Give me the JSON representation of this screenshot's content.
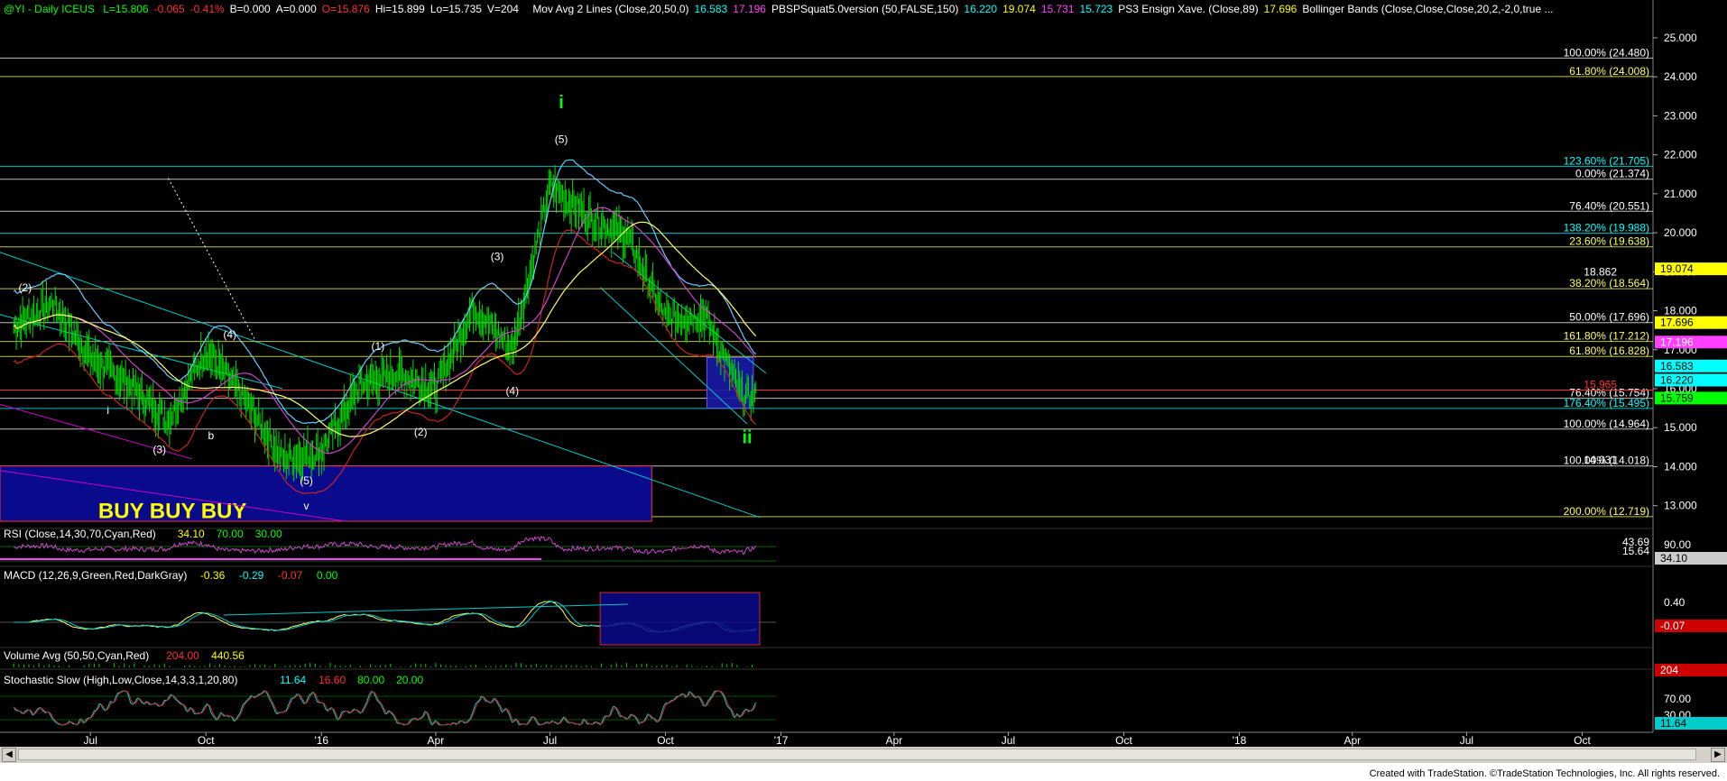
{
  "header": {
    "symbol": "@YI - Daily ICEUS",
    "quote": [
      {
        "label": "L=15.806",
        "color": "#00ff00"
      },
      {
        "label": "-0.065",
        "color": "#ff3030"
      },
      {
        "label": "-0.41%",
        "color": "#ff3030"
      },
      {
        "label": "B=0.000",
        "color": "#ffffff"
      },
      {
        "label": "A=0.000",
        "color": "#ffffff"
      },
      {
        "label": "O=15.876",
        "color": "#ff3030"
      },
      {
        "label": "Hi=15.899",
        "color": "#ffffff"
      },
      {
        "label": "Lo=15.735",
        "color": "#ffffff"
      },
      {
        "label": "V=204",
        "color": "#ffffff"
      }
    ],
    "studies": [
      {
        "label": "Mov Avg 2 Lines (Close,20,50,0)",
        "color": "#ffffff"
      },
      {
        "label": "16.583",
        "color": "#00ffff"
      },
      {
        "label": "17.196",
        "color": "#ff40ff"
      },
      {
        "label": "PBSPSquat5.0version (50,FALSE,150)",
        "color": "#ffffff"
      },
      {
        "label": "16.220",
        "color": "#00ffff"
      },
      {
        "label": "19.074",
        "color": "#ffff00"
      },
      {
        "label": "15.731",
        "color": "#ff40ff"
      },
      {
        "label": "15.723",
        "color": "#00ffff"
      },
      {
        "label": "PS3 Ensign Xave. (Close,89)",
        "color": "#ffffff"
      },
      {
        "label": "17.696",
        "color": "#ffff00"
      },
      {
        "label": "Bollinger Bands (Close,Close,Close,20,2,-2,0,true ...",
        "color": "#ffffff"
      }
    ]
  },
  "chart_data": {
    "type": "line",
    "x": [
      "2015-05-01",
      "2015-06-01",
      "2015-07-01",
      "2015-08-01",
      "2015-09-01",
      "2015-10-01",
      "2015-11-01",
      "2015-12-01",
      "2016-01-01",
      "2016-02-01",
      "2016-03-01",
      "2016-04-01",
      "2016-05-01",
      "2016-06-01",
      "2016-07-01",
      "2016-08-01",
      "2016-09-01",
      "2016-10-01",
      "2016-11-01",
      "2016-12-01"
    ],
    "series": [
      {
        "values": [
          17.6,
          18.2,
          16.8,
          16.1,
          15.2,
          17.0,
          15.7,
          14.2,
          14.4,
          16.1,
          16.4,
          16.0,
          18.1,
          17.0,
          21.2,
          20.4,
          19.9,
          17.8,
          17.9,
          15.8
        ]
      }
    ],
    "xticks": [
      "Jul",
      "Oct",
      "'16",
      "Apr",
      "Jul",
      "Oct",
      "'17",
      "Apr",
      "Jul",
      "Oct",
      "'18",
      "Apr",
      "Jul",
      "Oct"
    ],
    "yticks": [
      "25.000",
      "24.000",
      "23.000",
      "22.000",
      "21.000",
      "20.000",
      "19.000",
      "18.000",
      "17.000",
      "16.000",
      "15.000",
      "14.000",
      "13.000"
    ],
    "ylim": [
      12.6,
      25.6
    ],
    "last_price": "15.759",
    "price_markers": [
      {
        "value": 19.074,
        "label": "19.074",
        "bg": "#ffff00",
        "fg": "#000000"
      },
      {
        "value": 17.696,
        "label": "17.696",
        "bg": "#ffff00",
        "fg": "#000000"
      },
      {
        "value": 17.196,
        "label": "17.196",
        "bg": "#ff40ff",
        "fg": "#ffffff"
      },
      {
        "value": 16.583,
        "label": "16.583",
        "bg": "#00ffff",
        "fg": "#000000"
      },
      {
        "value": 16.22,
        "label": "16.220",
        "bg": "#00ffff",
        "fg": "#000000"
      },
      {
        "value": 15.759,
        "label": "15.759",
        "bg": "#00ff00",
        "fg": "#000000"
      }
    ],
    "fib_levels": [
      {
        "value": 24.48,
        "label": "100.00% (24.480)",
        "color": "#ffffff"
      },
      {
        "value": 24.008,
        "label": "61.80% (24.008)",
        "color": "#ffff66"
      },
      {
        "value": 21.705,
        "label": "123.60% (21.705)",
        "color": "#00ffff"
      },
      {
        "value": 21.374,
        "label": "0.00% (21.374)",
        "color": "#ffffff"
      },
      {
        "value": 20.551,
        "label": "76.40% (20.551)",
        "color": "#ffffff"
      },
      {
        "value": 19.988,
        "label": "138.20% (19.988)",
        "color": "#00ffff"
      },
      {
        "value": 19.638,
        "label": "23.60% (19.638)",
        "color": "#ffff66"
      },
      {
        "value": 18.564,
        "label": "38.20% (18.564)",
        "color": "#ffff66"
      },
      {
        "value": 17.696,
        "label": "50.00% (17.696)",
        "color": "#ffffff"
      },
      {
        "value": 17.212,
        "label": "161.80% (17.212)",
        "color": "#ffff66"
      },
      {
        "value": 16.828,
        "label": "61.80% (16.828)",
        "color": "#ffff66"
      },
      {
        "value": 15.754,
        "label": "76.40% (15.754)",
        "color": "#ffffff"
      },
      {
        "value": 15.495,
        "label": "176.40% (15.495)",
        "color": "#00ffff"
      },
      {
        "value": 14.964,
        "label": "100.00% (14.964)",
        "color": "#ffffff"
      },
      {
        "value": 14.018,
        "label": "100.00% (14.018)",
        "color": "#ffffff"
      },
      {
        "value": 12.719,
        "label": "200.00% (12.719)",
        "color": "#ffff66"
      }
    ],
    "annotations": [
      {
        "text": "18.862",
        "value": 18.862,
        "color": "#ffffff"
      },
      {
        "text": "15.965",
        "value": 15.965,
        "color": "#ff3030"
      },
      {
        "text": "14.031",
        "value": 14.031,
        "color": "#ffffff"
      }
    ],
    "wave_labels": [
      {
        "text": "i",
        "date": "2016-07-10",
        "value": 23.2,
        "color": "#00ff00",
        "size": "big"
      },
      {
        "text": "(5)",
        "date": "2016-07-10",
        "value": 22.3,
        "color": "#ffffff"
      },
      {
        "text": "(3)",
        "date": "2016-05-20",
        "value": 19.3,
        "color": "#ffffff"
      },
      {
        "text": "(4)",
        "date": "2016-06-01",
        "value": 15.85,
        "color": "#ffffff"
      },
      {
        "text": "(1)",
        "date": "2016-02-15",
        "value": 17.0,
        "color": "#ffffff"
      },
      {
        "text": "(2)",
        "date": "2016-03-20",
        "value": 14.8,
        "color": "#ffffff"
      },
      {
        "text": "(4)",
        "date": "2015-10-20",
        "value": 17.3,
        "color": "#ffffff"
      },
      {
        "text": "(2)",
        "date": "2015-05-10",
        "value": 18.5,
        "color": "#ffffff"
      },
      {
        "text": "(3)",
        "date": "2015-08-25",
        "value": 14.35,
        "color": "#ffffff"
      },
      {
        "text": "b",
        "date": "2015-10-05",
        "value": 14.7,
        "color": "#ffffff"
      },
      {
        "text": "i",
        "date": "2015-07-15",
        "value": 15.35,
        "color": "#ffffff"
      },
      {
        "text": "(5)",
        "date": "2015-12-20",
        "value": 13.55,
        "color": "#ffffff"
      },
      {
        "text": "v",
        "date": "2015-12-20",
        "value": 12.9,
        "color": "#ffffff"
      },
      {
        "text": "ii",
        "date": "2016-12-05",
        "value": 14.6,
        "color": "#00ff00",
        "size": "big"
      }
    ],
    "buy_box_text": "BUY BUY BUY"
  },
  "panels": {
    "rsi": {
      "title": "RSI (Close,14,30,70,Cyan,Red)",
      "values": [
        {
          "t": "34.10",
          "c": "#ffff00"
        },
        {
          "t": "70.00",
          "c": "#00ff00"
        },
        {
          "t": "30.00",
          "c": "#00ff00"
        }
      ],
      "scale": [
        "90.00",
        "43.69",
        "15.64"
      ],
      "marker": "34.10"
    },
    "macd": {
      "title": "MACD (12,26,9,Green,Red,DarkGray)",
      "values": [
        {
          "t": "-0.36",
          "c": "#ffff00"
        },
        {
          "t": "-0.29",
          "c": "#00ffff"
        },
        {
          "t": "-0.07",
          "c": "#ff3030"
        },
        {
          "t": "0.00",
          "c": "#00ff00"
        }
      ],
      "scale": [
        "0.40"
      ],
      "marker": "-0.07"
    },
    "volume": {
      "title": "Volume Avg (50,50,Cyan,Red)",
      "values": [
        {
          "t": "204.00",
          "c": "#ff3030"
        },
        {
          "t": "440.56",
          "c": "#ffff00"
        }
      ],
      "marker": "204"
    },
    "stoch": {
      "title": "Stochastic Slow (High,Low,Close,14,3,3,1,20,80)",
      "values": [
        {
          "t": "11.64",
          "c": "#00ffff"
        },
        {
          "t": "16.60",
          "c": "#ff3030"
        },
        {
          "t": "80.00",
          "c": "#00ff00"
        },
        {
          "t": "20.00",
          "c": "#00ff00"
        }
      ],
      "scale": [
        "70.00",
        "30.00"
      ],
      "marker": "11.64"
    }
  },
  "footer": "Created with TradeStation. ©TradeStation Technologies, Inc. All rights reserved."
}
